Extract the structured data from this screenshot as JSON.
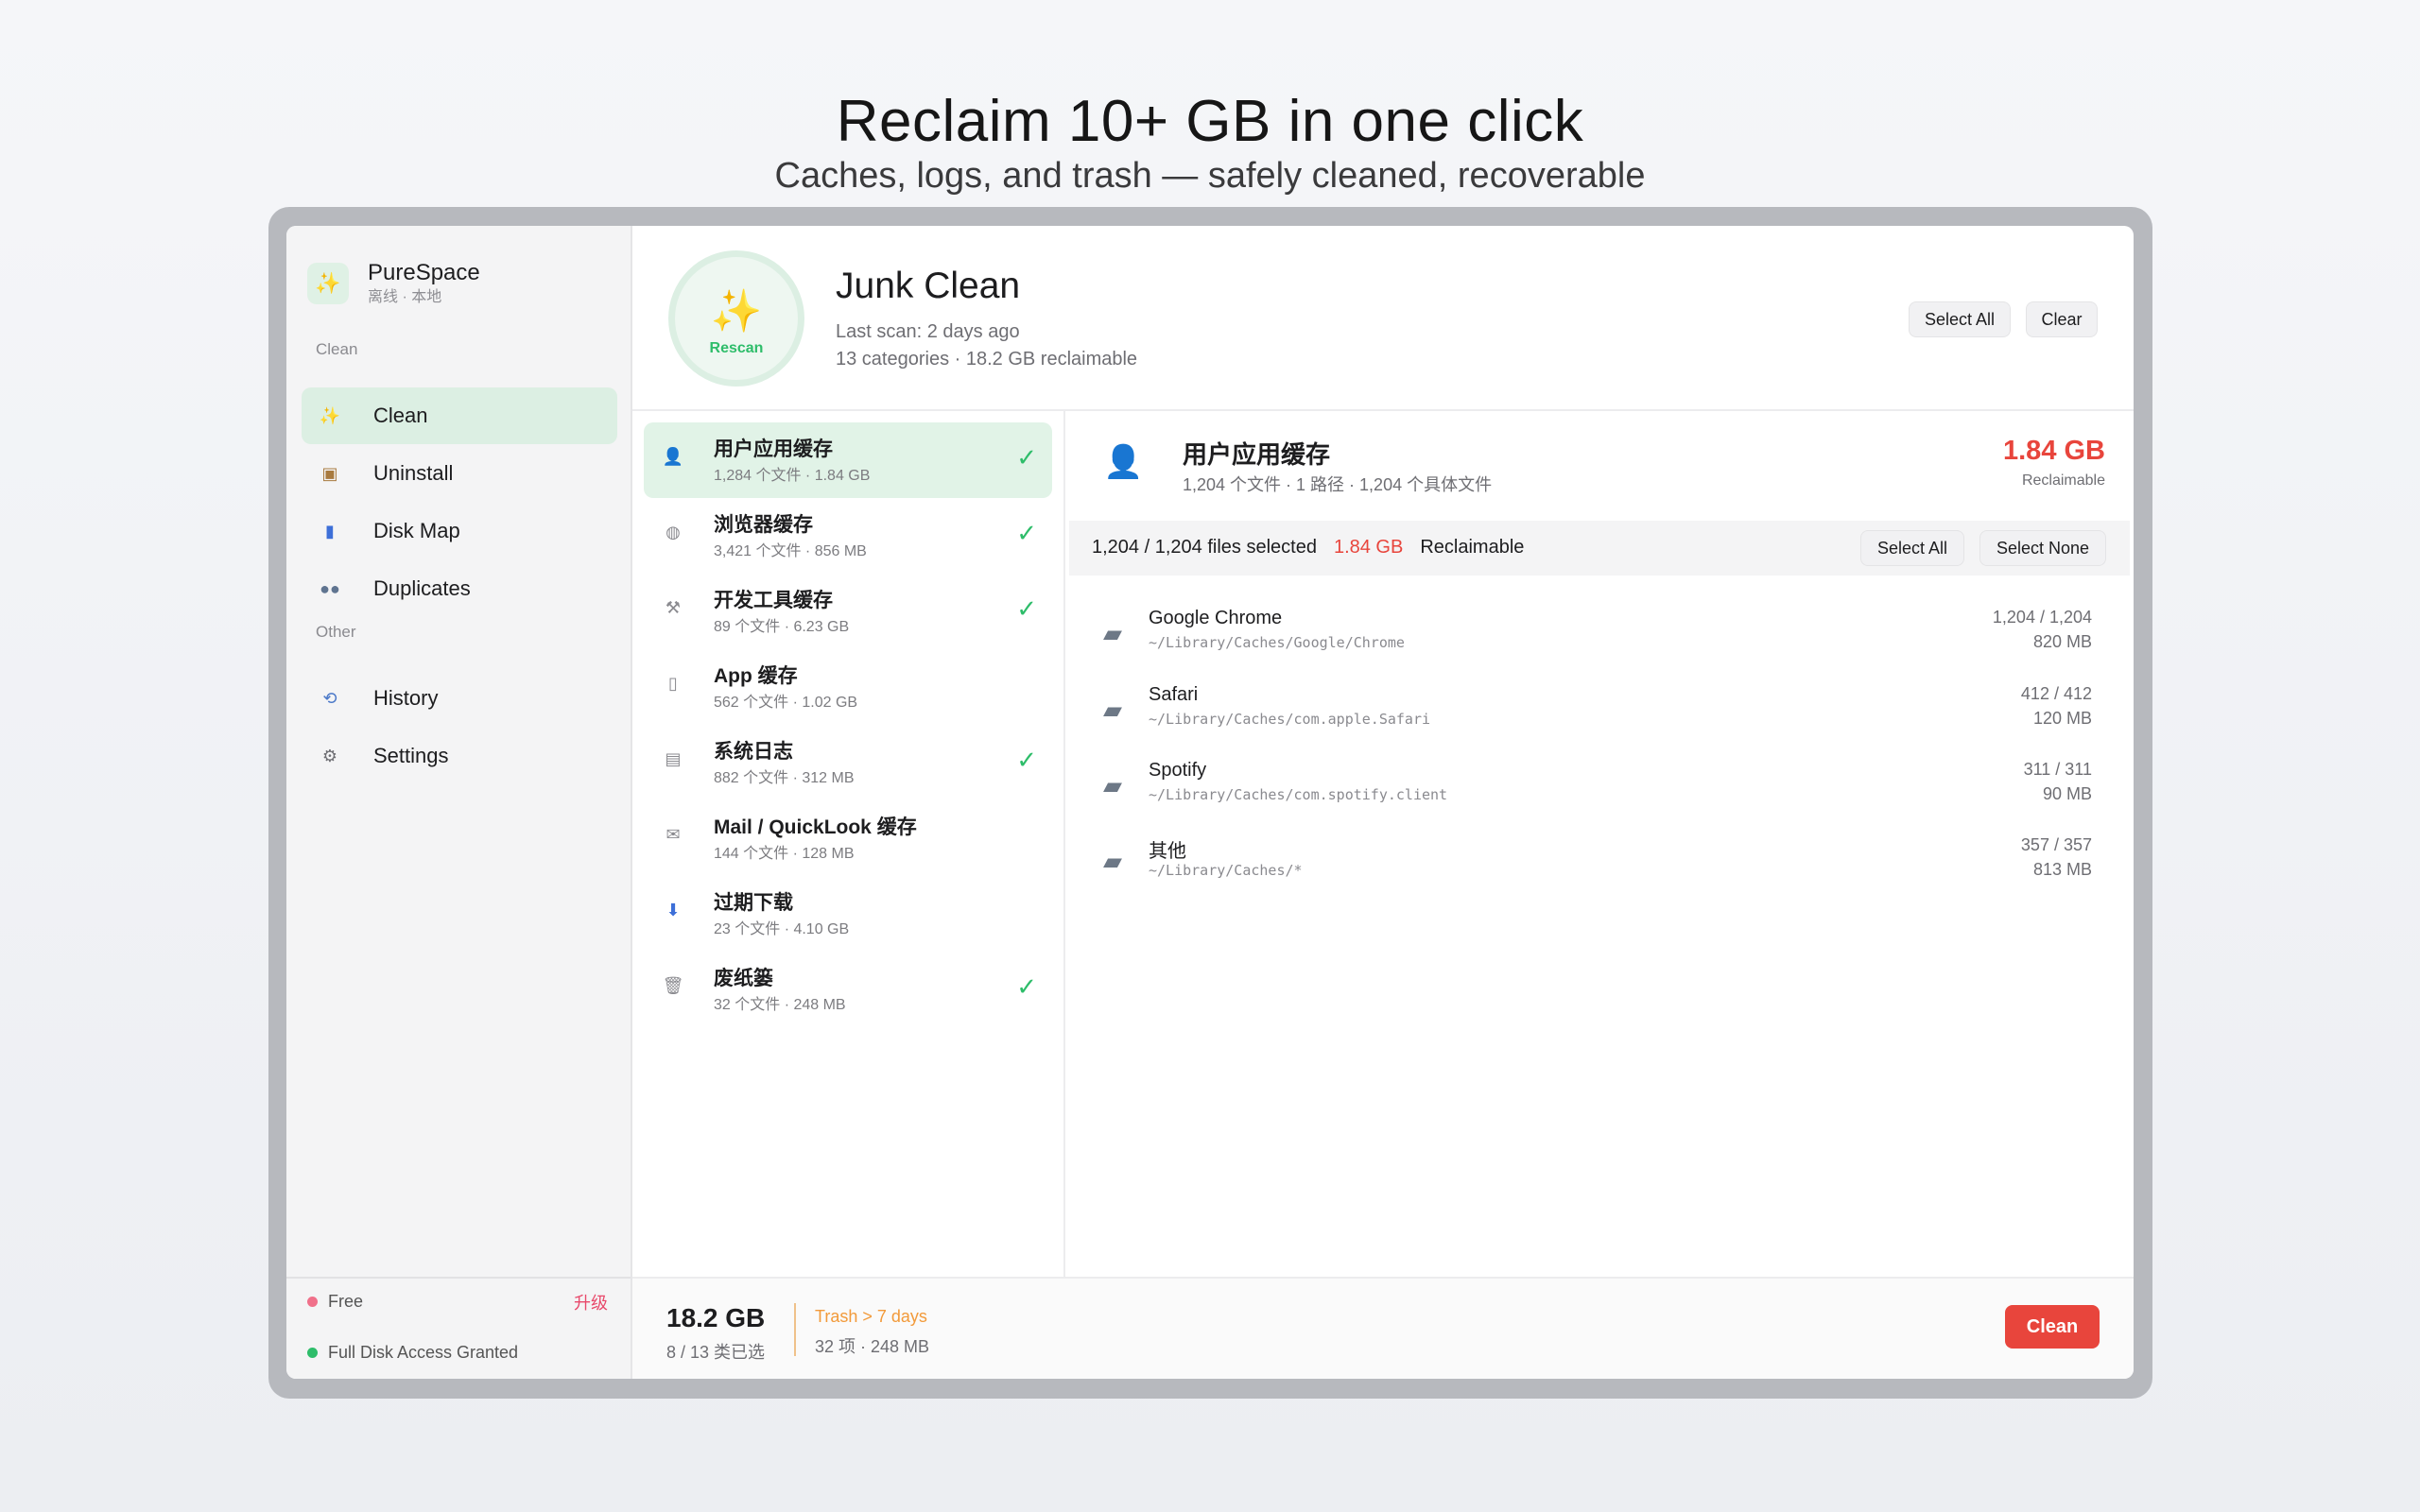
{
  "hero": {
    "title": "Reclaim 10+ GB in one click",
    "subtitle": "Caches, logs, and trash — safely cleaned, recoverable"
  },
  "app": {
    "name": "PureSpace",
    "status": "离线 · 本地",
    "logo_icon": "sparkles-icon"
  },
  "sidebar": {
    "section_clean": "Clean",
    "section_other": "Other",
    "items": [
      {
        "label": "Clean",
        "icon": "sparkles-icon",
        "active": true
      },
      {
        "label": "Uninstall",
        "icon": "package-icon"
      },
      {
        "label": "Disk Map",
        "icon": "bar-chart-icon"
      },
      {
        "label": "Duplicates",
        "icon": "people-icon"
      },
      {
        "label": "History",
        "icon": "history-icon"
      },
      {
        "label": "Settings",
        "icon": "gear-icon"
      }
    ],
    "plan": "Free",
    "upgrade": "升级",
    "disk_access": "Full Disk Access Granted"
  },
  "header": {
    "title": "Junk Clean",
    "last_scan": "Last scan: 2 days ago",
    "summary": "13 categories · 18.2 GB reclaimable",
    "rescan": "Rescan",
    "select_all": "Select All",
    "clear": "Clear"
  },
  "categories": [
    {
      "title": "用户应用缓存",
      "meta": "1,284 个文件 · 1.84 GB",
      "checked": true,
      "active": true,
      "icon": "user-icon"
    },
    {
      "title": "浏览器缓存",
      "meta": "3,421 个文件 · 856 MB",
      "checked": true,
      "icon": "globe-icon"
    },
    {
      "title": "开发工具缓存",
      "meta": "89 个文件 · 6.23 GB",
      "checked": true,
      "icon": "hammer-icon"
    },
    {
      "title": "App 缓存",
      "meta": "562 个文件 · 1.02 GB",
      "checked": false,
      "icon": "phone-icon"
    },
    {
      "title": "系统日志",
      "meta": "882 个文件 · 312 MB",
      "checked": true,
      "icon": "document-icon"
    },
    {
      "title": "Mail / QuickLook 缓存",
      "meta": "144 个文件 · 128 MB",
      "checked": false,
      "icon": "mail-icon"
    },
    {
      "title": "过期下载",
      "meta": "23 个文件 · 4.10 GB",
      "checked": false,
      "icon": "download-icon"
    },
    {
      "title": "废纸篓",
      "meta": "32 个文件 · 248 MB",
      "checked": true,
      "icon": "trash-icon"
    }
  ],
  "detail": {
    "title": "用户应用缓存",
    "subtitle": "1,204 个文件 · 1 路径 · 1,204 个具体文件",
    "size": "1.84 GB",
    "size_label": "Reclaimable",
    "selection_text": "1,204 / 1,204 files selected",
    "selection_size": "1.84 GB",
    "selection_label": "Reclaimable",
    "select_all": "Select All",
    "select_none": "Select None",
    "files": [
      {
        "name": "Google Chrome",
        "path": "~/Library/Caches/Google/Chrome",
        "count": "1,204 / 1,204",
        "size": "820 MB"
      },
      {
        "name": "Safari",
        "path": "~/Library/Caches/com.apple.Safari",
        "count": "412 / 412",
        "size": "120 MB"
      },
      {
        "name": "Spotify",
        "path": "~/Library/Caches/com.spotify.client",
        "count": "311 / 311",
        "size": "90 MB"
      },
      {
        "name": "其他",
        "path": "~/Library/Caches/*",
        "count": "357 / 357",
        "size": "813 MB"
      }
    ]
  },
  "footer": {
    "total": "18.2 GB",
    "selected": "8 / 13 类已选",
    "trash_title": "Trash > 7 days",
    "trash_meta": "32 项 · 248 MB",
    "clean": "Clean"
  },
  "colors": {
    "accent_green": "#2ebd6a",
    "accent_red": "#e8453c",
    "accent_orange": "#f29a3a",
    "upgrade_pink": "#e8496b"
  }
}
